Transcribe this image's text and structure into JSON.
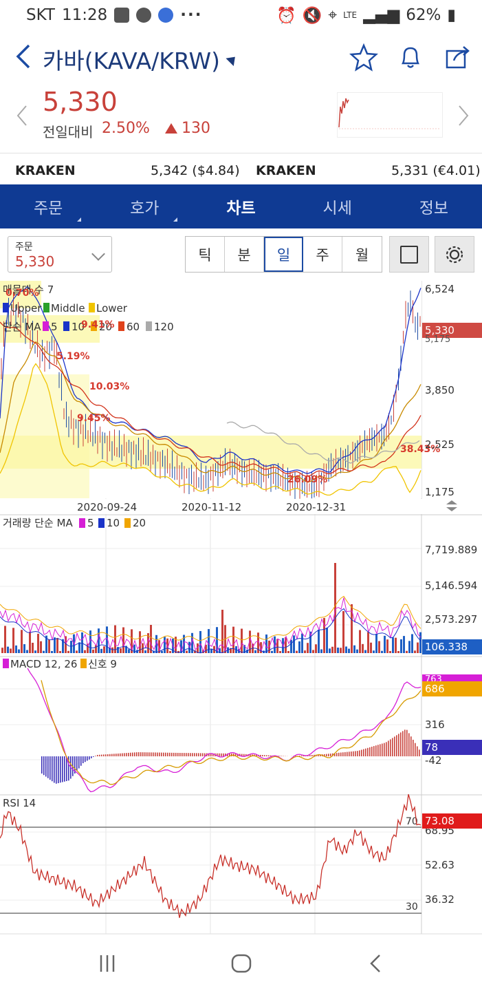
{
  "status": {
    "carrier": "SKT",
    "time": "11:28",
    "dots": "···",
    "network": "LTE",
    "battery": "62%"
  },
  "header": {
    "title": "카바(KAVA/KRW)"
  },
  "quote": {
    "price": "5,330",
    "change_label": "전일대비",
    "change_pct": "2.50%",
    "change_abs": "130"
  },
  "exchanges": [
    {
      "name": "KRAKEN",
      "value": "5,342 ($4.84)"
    },
    {
      "name": "KRAKEN",
      "value": "5,331 (€4.01)"
    }
  ],
  "tabs": [
    {
      "label": "주문",
      "active": false
    },
    {
      "label": "호가",
      "active": false
    },
    {
      "label": "차트",
      "active": true
    },
    {
      "label": "시세",
      "active": false
    },
    {
      "label": "정보",
      "active": false
    }
  ],
  "toolbar": {
    "order_label": "주문",
    "order_value": "5,330",
    "periods": [
      "틱",
      "분",
      "일",
      "주",
      "월"
    ],
    "selected_period": "일"
  },
  "chart": {
    "price_panel": {
      "legend1": "매물대 수 7",
      "bb": [
        "Upper",
        "Middle",
        "Lower"
      ],
      "ma_label": "단순 MA",
      "ma_periods": [
        "5",
        "10",
        "20",
        "60",
        "120"
      ],
      "ma_colors": [
        "#d61fd6",
        "#1a33c8",
        "#f0a500",
        "#e0421b",
        "#aaaaaa"
      ],
      "y_ticks": [
        "6,524",
        "3,850",
        "2,525",
        "1,175"
      ],
      "current": "5,330",
      "current_sub": "5,175",
      "x_ticks": [
        "2020-09-24",
        "2020-11-12",
        "2020-12-31"
      ],
      "volume_profile": [
        "0.70%",
        "5.19%",
        "10.03%",
        "9.45%",
        "38.43%",
        "26.09%",
        "9.41%"
      ]
    },
    "volume_panel": {
      "legend": "거래량 단순 MA",
      "ma_periods": [
        "5",
        "10",
        "20"
      ],
      "y_ticks": [
        "7,719.889",
        "5,146.594",
        "2,573.297"
      ],
      "current": "106.338"
    },
    "macd_panel": {
      "legend": "MACD 12, 26",
      "signal": "신호 9",
      "y_ticks": [
        "316",
        "-42"
      ],
      "macd_value": "763",
      "signal_value": "686",
      "hist_value": "78"
    },
    "rsi_panel": {
      "legend": "RSI 14",
      "y_ticks": [
        "68.95",
        "52.63",
        "36.32"
      ],
      "upper": "70",
      "lower": "30",
      "current": "73.08"
    }
  }
}
